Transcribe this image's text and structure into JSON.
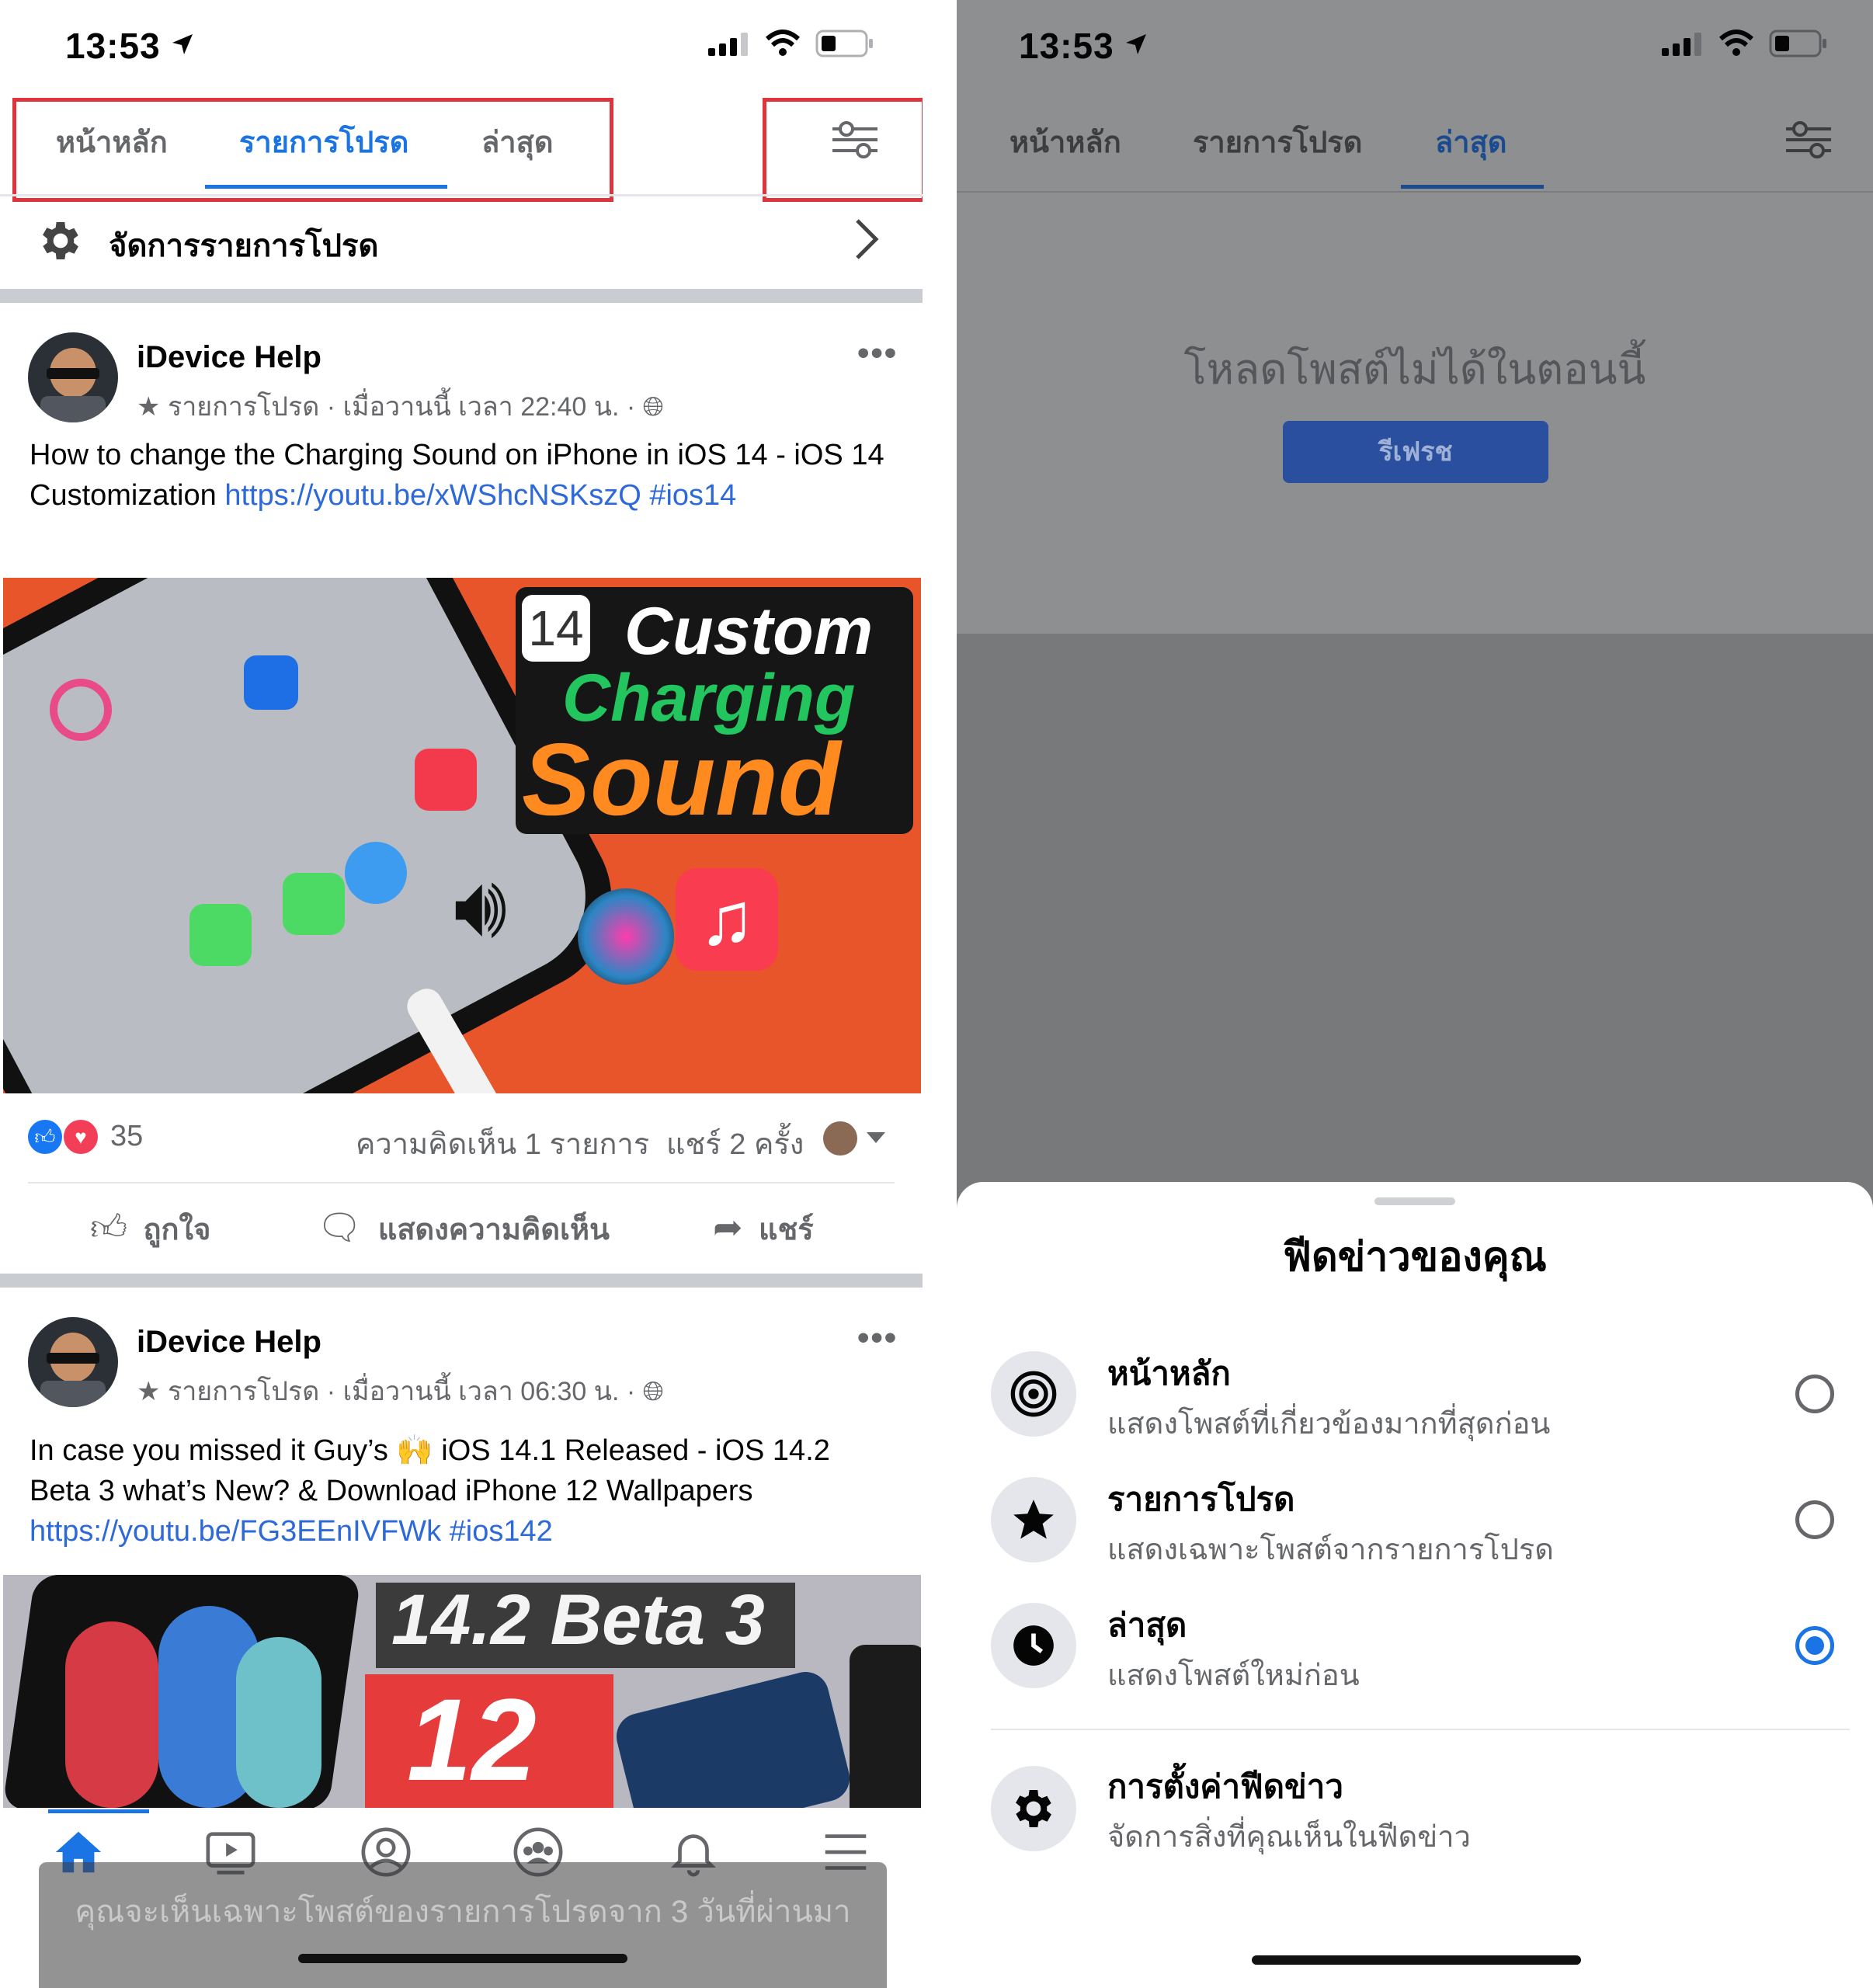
{
  "left": {
    "status": {
      "time": "13:53"
    },
    "tabs": [
      {
        "label": "หน้าหลัก",
        "active": false
      },
      {
        "label": "รายการโปรด",
        "active": true
      },
      {
        "label": "ล่าสุด",
        "active": false
      }
    ],
    "filter_icon": "sliders-icon",
    "manage_row": {
      "label": "จัดการรายการโปรด"
    },
    "posts": [
      {
        "author": "iDevice Help",
        "meta_tag": "รายการโปรด",
        "meta_time": "เมื่อวานนี้ เวลา 22:40 น.",
        "text": "How to change the Charging Sound on iPhone in iOS 14 - iOS 14 Customization ",
        "link": "https://youtu.be/xWShcNSKszQ",
        "hashtag": "#ios14",
        "thumb_badge": "14",
        "thumb_line1": "Custom",
        "thumb_line2": "Charging",
        "thumb_line3": "Sound",
        "reaction_count": "35",
        "comments": "ความคิดเห็น 1 รายการ",
        "shares": "แชร์ 2 ครั้ง",
        "actions": {
          "like": "ถูกใจ",
          "comment": "แสดงความคิดเห็น",
          "share": "แชร์"
        }
      },
      {
        "author": "iDevice Help",
        "meta_tag": "รายการโปรด",
        "meta_time": "เมื่อวานนี้ เวลา 06:30 น.",
        "text_a": "In case you missed it Guy’s ",
        "emoji": "🙌",
        "text_b": " iOS 14.1 Released - iOS 14.2 Beta 3 what’s New? & Download iPhone 12 Wallpapers ",
        "link": "https://youtu.be/FG3EEnIVFWk",
        "hashtag": "#ios142",
        "thumb_line1": "14.2 Beta 3",
        "thumb_line2": "12"
      }
    ],
    "toast": "คุณจะเห็นเฉพาะโพสต์ของรายการโปรดจาก 3 วันที่ผ่านมา",
    "bottom_nav": [
      "home-icon",
      "watch-icon",
      "profile-icon",
      "groups-icon",
      "bell-icon",
      "menu-icon"
    ]
  },
  "right": {
    "status": {
      "time": "13:53"
    },
    "tabs": [
      {
        "label": "หน้าหลัก",
        "active": false
      },
      {
        "label": "รายการโปรด",
        "active": false
      },
      {
        "label": "ล่าสุด",
        "active": true
      }
    ],
    "error_text": "โหลดโพสต์ไม่ได้ในตอนนี้",
    "refresh_label": "รีเฟรช",
    "sheet": {
      "title": "ฟีดข่าวของคุณ",
      "options": [
        {
          "title": "หน้าหลัก",
          "subtitle": "แสดงโพสต์ที่เกี่ยวข้องมากที่สุดก่อน",
          "icon": "target-icon",
          "selected": false
        },
        {
          "title": "รายการโปรด",
          "subtitle": "แสดงเฉพาะโพสต์จากรายการโปรด",
          "icon": "star-icon",
          "selected": false
        },
        {
          "title": "ล่าสุด",
          "subtitle": "แสดงโพสต์ใหม่ก่อน",
          "icon": "clock-icon",
          "selected": true
        }
      ],
      "settings": {
        "title": "การตั้งค่าฟีดข่าว",
        "subtitle": "จัดการสิ่งที่คุณเห็นในฟีดข่าว",
        "icon": "gear-icon"
      }
    }
  },
  "colors": {
    "accent": "#1b74e4",
    "highlight_box": "#e0343c",
    "refresh_button": "#2a5bd7",
    "like_blue": "#1877f2",
    "love_red": "#f33e58"
  }
}
